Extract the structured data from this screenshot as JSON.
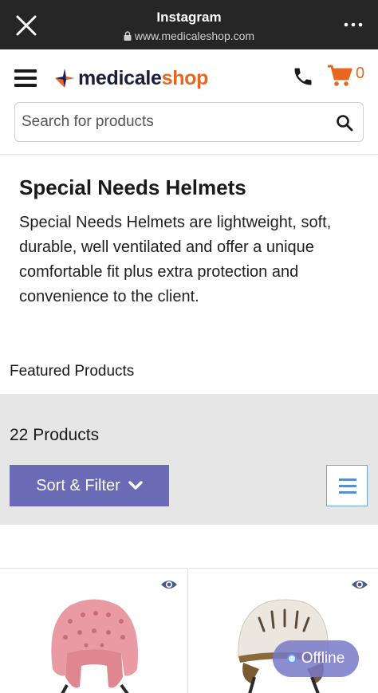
{
  "browser": {
    "title": "Instagram",
    "url": "www.medicaleshop.com"
  },
  "header": {
    "logo_main": "medicale",
    "logo_accent": "shop",
    "cart_count": "0",
    "search_placeholder": "Search for products",
    "accent_color": "#e8661f"
  },
  "category": {
    "title": "Special Needs Helmets",
    "description": "Special Needs Helmets are lightweight, soft, durable, well ventilated and offer a unique comfortable fit plus extra protection and convenience to the client."
  },
  "featured_label": "Featured Products",
  "listing": {
    "count_label": "22 Products",
    "sort_label": "Sort & Filter",
    "button_color": "#6b6bb5"
  },
  "products": [
    {
      "image": "pink-soft-helmet",
      "icon": "eye-icon"
    },
    {
      "image": "white-hard-shell-helmet",
      "icon": "eye-icon"
    }
  ],
  "chat": {
    "status_label": "Offline"
  }
}
